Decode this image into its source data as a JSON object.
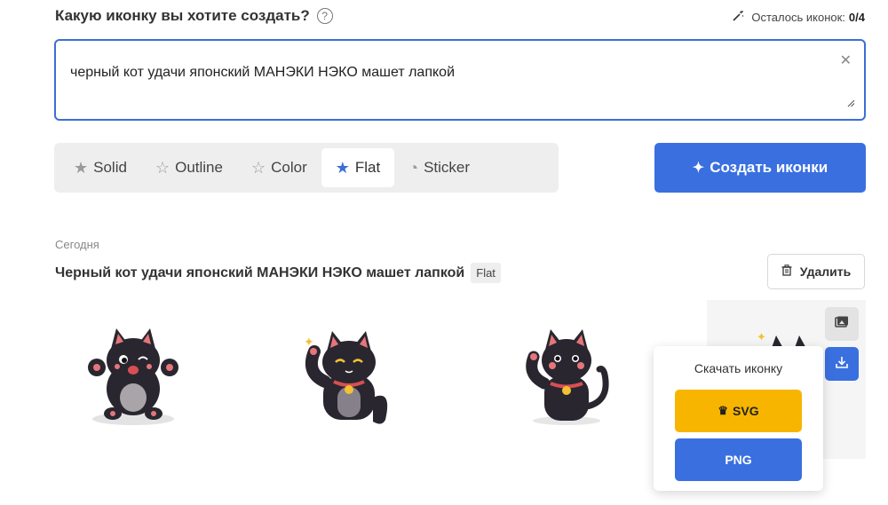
{
  "header": {
    "question": "Какую иконку вы хотите создать?",
    "help_icon": "question-circle-icon",
    "remaining_label": "Осталось иконок:",
    "remaining_value": "0/4"
  },
  "prompt": {
    "value": "черный кот удачи японский МАНЭКИ НЭКО машет лапкой",
    "clear_symbol": "✕"
  },
  "styles": [
    {
      "label": "Solid",
      "icon": "star-filled-icon",
      "glyph": "★",
      "active": false
    },
    {
      "label": "Outline",
      "icon": "star-outline-icon",
      "glyph": "☆",
      "active": false
    },
    {
      "label": "Color",
      "icon": "star-outline-icon",
      "glyph": "☆",
      "active": false
    },
    {
      "label": "Flat",
      "icon": "star-blue-icon",
      "glyph": "★",
      "active": true
    },
    {
      "label": "Sticker",
      "icon": "sticker-icon",
      "glyph": "◔",
      "active": false
    }
  ],
  "create_button": {
    "label": "Создать иконки",
    "icon": "sparkles-icon"
  },
  "results": {
    "date_label": "Сегодня",
    "title": "Черный кот удачи японский МАНЭКИ НЭКО машет лапкой",
    "style_badge": "Flat",
    "delete_label": "Удалить"
  },
  "download_popup": {
    "title": "Скачать иконку",
    "svg_label": "SVG",
    "png_label": "PNG"
  },
  "colors": {
    "accent": "#3a6fe0",
    "svg_button": "#f7b500"
  }
}
